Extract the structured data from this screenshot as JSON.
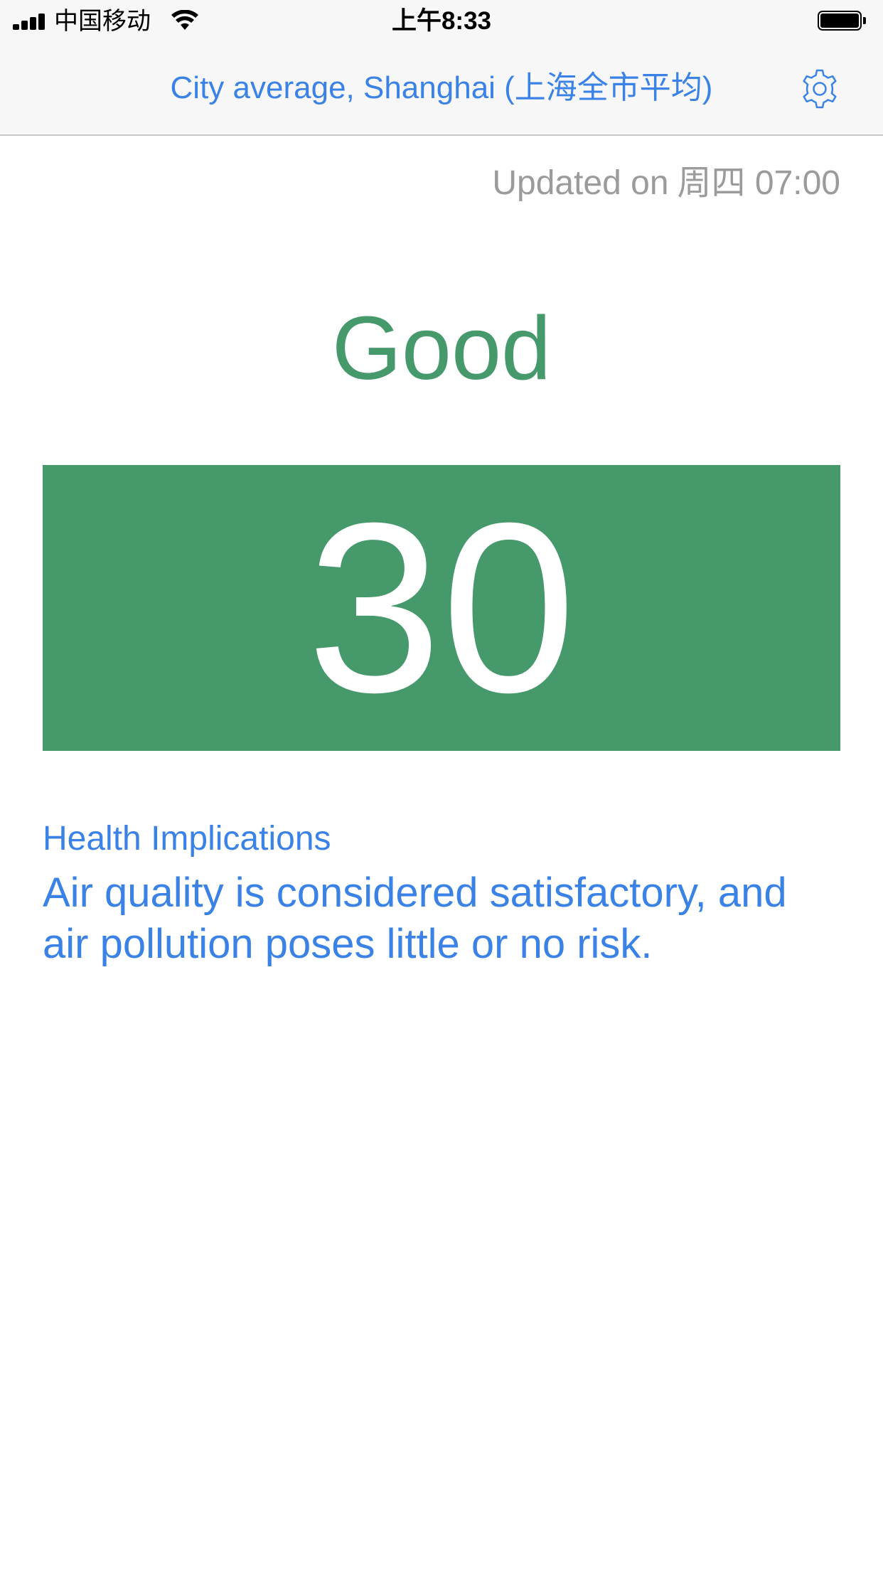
{
  "status_bar": {
    "carrier": "中国移动",
    "time": "上午8:33"
  },
  "nav": {
    "title": "City average, Shanghai (上海全市平均)",
    "settings_icon": "gear-icon"
  },
  "updated": {
    "prefix": "Updated on",
    "value": "周四 07:00"
  },
  "air_quality": {
    "level": "Good",
    "aqi": "30",
    "color": "#45996b"
  },
  "health": {
    "heading": "Health Implications",
    "text": "Air quality is considered satisfactory, and air pollution poses little or no risk."
  },
  "colors": {
    "accent": "#3b82e6",
    "good": "#45996b",
    "muted": "#9b9b9b"
  }
}
